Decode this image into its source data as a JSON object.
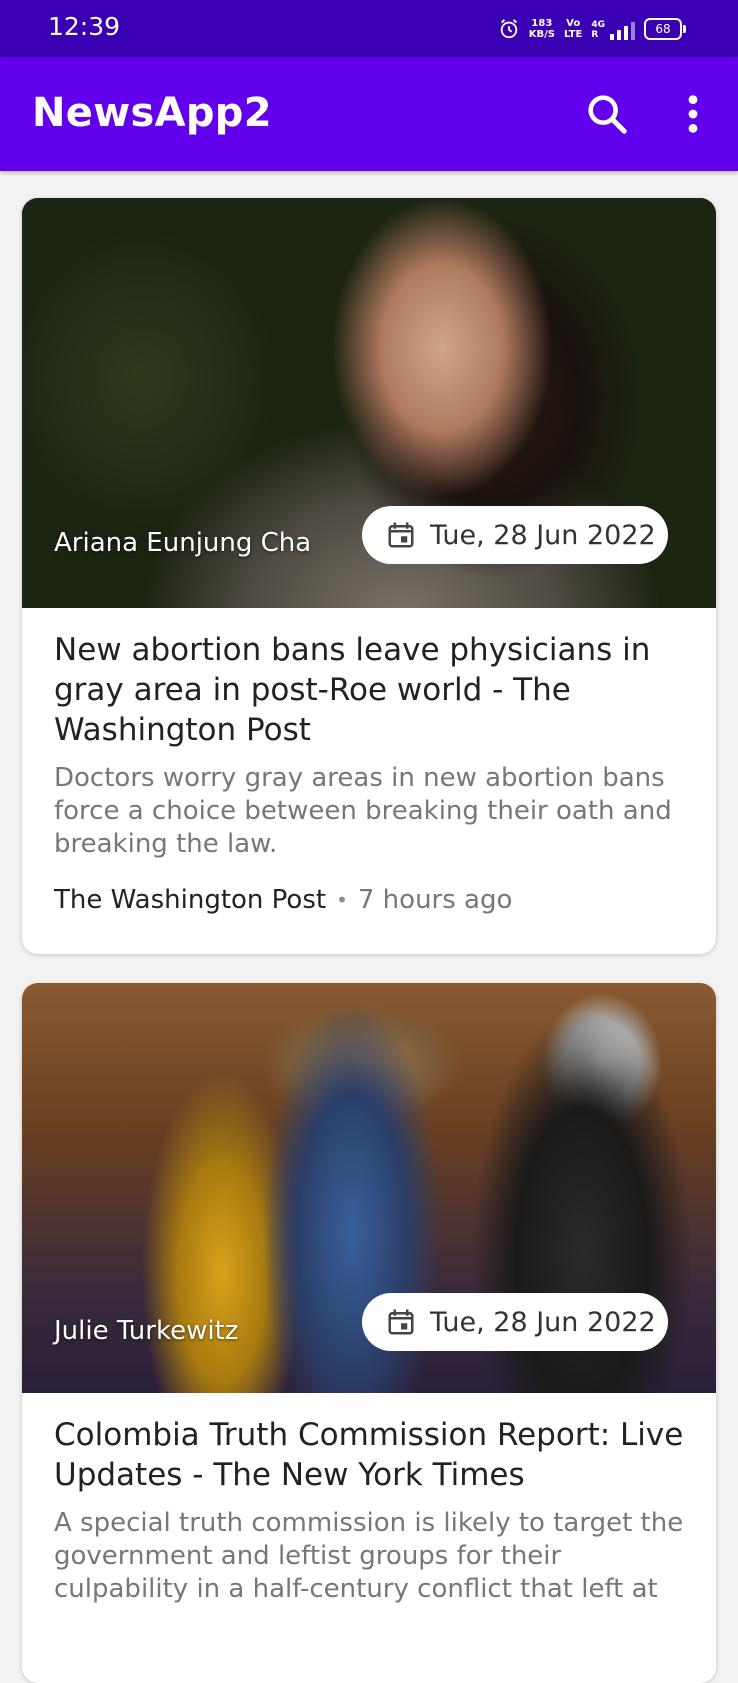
{
  "status_bar": {
    "time": "12:39",
    "net_speed_value": "183",
    "net_speed_unit": "KB/S",
    "volte_top": "Vo",
    "volte_bottom": "LTE",
    "network_type": "4G",
    "network_sub": "R",
    "battery": "68",
    "icons": [
      "alarm-icon",
      "signal-icon",
      "battery-icon"
    ]
  },
  "app_bar": {
    "title": "NewsApp2",
    "actions": [
      "search-icon",
      "more-vert-icon"
    ],
    "color": "#6200ee",
    "status_color": "#3b00b3"
  },
  "articles": [
    {
      "author": "Ariana Eunjung Cha",
      "date": "Tue, 28 Jun 2022",
      "title": "New abortion bans leave physicians in gray area in post-Roe world - The Washington Post",
      "description": "Doctors worry gray areas in new abortion bans force a choice between breaking their oath and breaking the law.",
      "source": "The Washington Post",
      "time": "7 hours ago"
    },
    {
      "author": "Julie Turkewitz",
      "date": "Tue, 28 Jun 2022",
      "title": "Colombia Truth Commission Report: Live Updates - The New York Times",
      "description": "A special truth commission is likely to target the government and leftist groups for their culpability in a half-century conflict that left at"
    }
  ]
}
